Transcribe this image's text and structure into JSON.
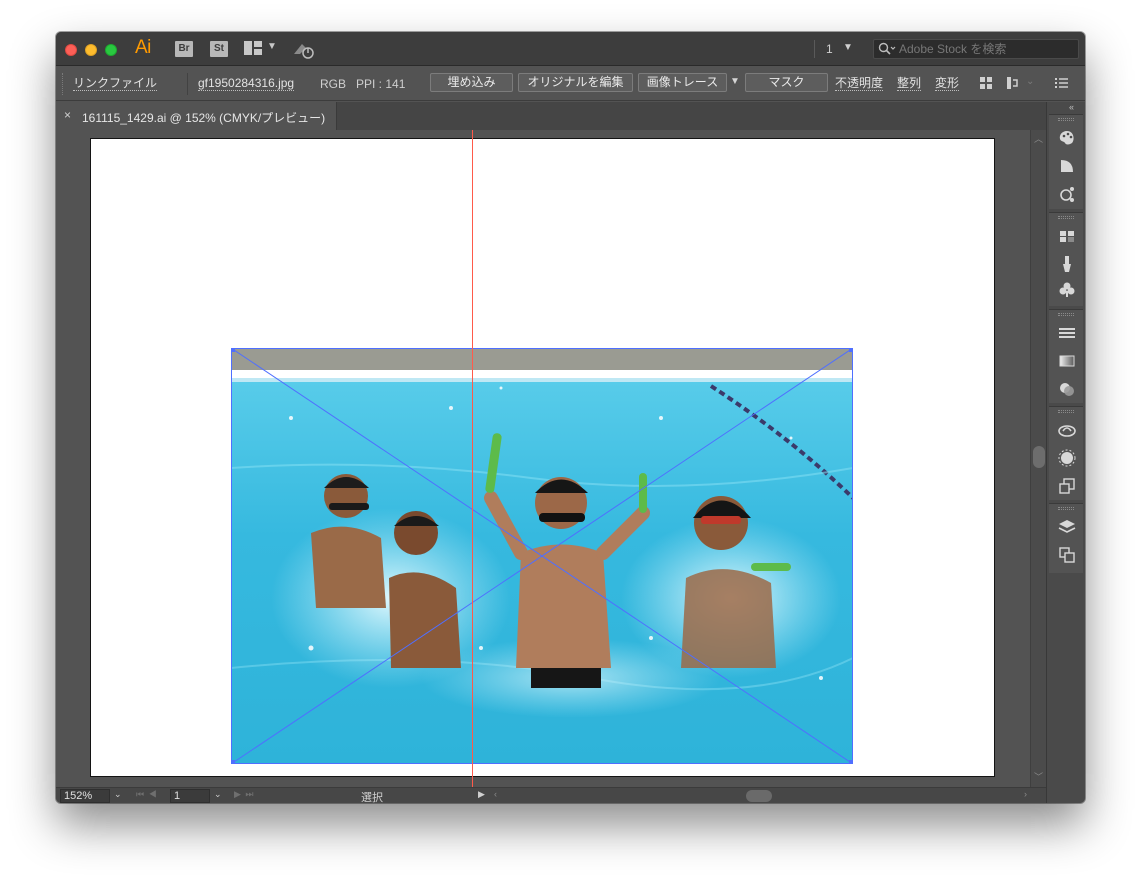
{
  "titlebar": {
    "app_logo": "Ai",
    "bridge_label": "Br",
    "stock_label": "St",
    "page_number": "1",
    "stock_search_placeholder": "Adobe Stock を検索"
  },
  "control_bar": {
    "link_file_label": "リンクファイル",
    "file_name": "gf1950284316.jpg",
    "color_mode": "RGB",
    "ppi": "PPI : 141",
    "embed_button": "埋め込み",
    "edit_original_button": "オリジナルを編集",
    "image_trace_button": "画像トレース",
    "mask_button": "マスク",
    "opacity_label": "不透明度",
    "align_label": "整列",
    "transform_label": "変形"
  },
  "document_tab": {
    "close_glyph": "×",
    "title": "161115_1429.ai @ 152% (CMYK/プレビュー)"
  },
  "status_bar": {
    "zoom": "152%",
    "artboard_number": "1",
    "status": "選択"
  },
  "colors": {
    "ui_background": "#535353",
    "titlebar": "#3d3d3d",
    "selection_blue": "#4f6fff",
    "guide_red": "#ff5a4a",
    "pool_water": "#3fbfe0",
    "ai_orange": "#ff9a00"
  },
  "icons": {
    "dock": [
      "color-palette-icon",
      "gradient-icon",
      "symbols-icon",
      "swatches-icon",
      "brushes-icon",
      "symbol-club-icon",
      "stroke-icon",
      "gradient-panel-icon",
      "transparency-icon",
      "cc-libraries-icon",
      "appearance-icon",
      "graphic-styles-icon",
      "layers-icon",
      "artboards-icon"
    ]
  }
}
